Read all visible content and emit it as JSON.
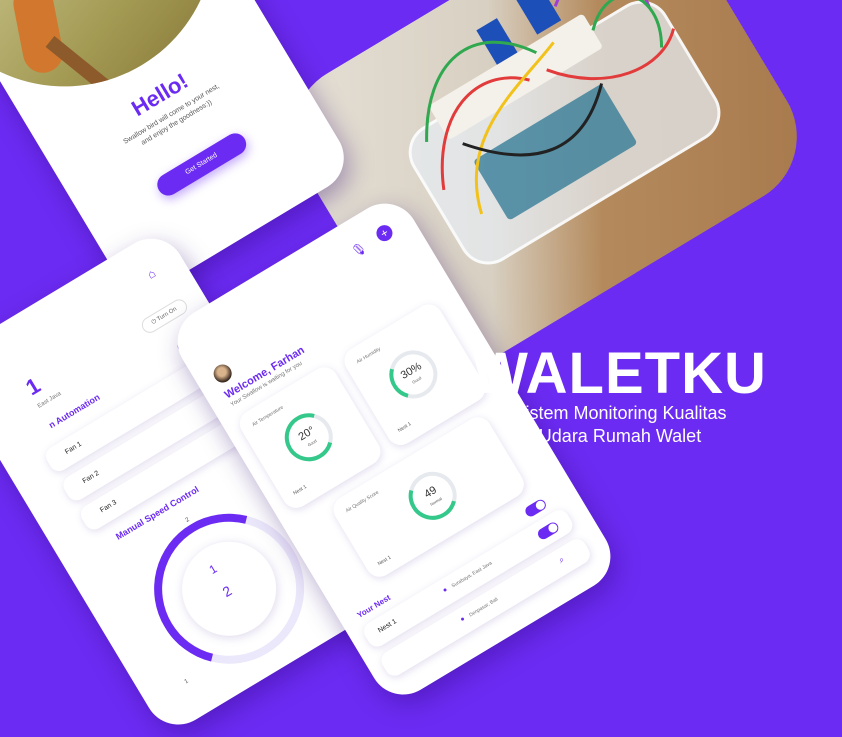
{
  "brand": {
    "title": "WALETKU",
    "subtitle_line1": "Sistem Monitoring Kualitas",
    "subtitle_line2": "Udara Rumah Walet"
  },
  "colors": {
    "accent": "#6c2bf2",
    "good": "#34c98a",
    "white": "#ffffff"
  },
  "onboarding": {
    "heading": "Hello!",
    "body_line1": "Swallow bird will come to your nest,",
    "body_line2": "and enjoy the goodness:))",
    "cta": "Get Started"
  },
  "automation_screen": {
    "title_fragment": "1",
    "location_fragment": "East Java",
    "turn_on_label": "Turn On",
    "section_automation": "n Automation",
    "fans": [
      "Fan 1",
      "Fan 2",
      "Fan 3"
    ],
    "section_speed": "Manual Speed Control",
    "dial_current": "2",
    "dial_ticks": [
      "1",
      "2",
      "3"
    ],
    "dial_inner_top": "1"
  },
  "dashboard": {
    "greeting": "Welcome, Farhan",
    "subgreeting": "Your Swallow is waiting for you",
    "cards": [
      {
        "label": "Air Temperature",
        "value": "20°",
        "status": "Good",
        "nest": "Nest 1",
        "level": 0.6
      },
      {
        "label": "Air Humidity",
        "value": "30%",
        "status": "Good",
        "nest": "Nest 1",
        "level": 0.3
      },
      {
        "label": "Air Quality Score",
        "value": "49",
        "status": "Normal",
        "nest": "Nest 1",
        "level": 0.49
      }
    ],
    "your_nest_label": "Your Nest",
    "nests": [
      {
        "name": "Nest 1",
        "location": "Surabaya, East Java"
      },
      {
        "name": "",
        "location": "Denpasar, Bali"
      }
    ]
  }
}
